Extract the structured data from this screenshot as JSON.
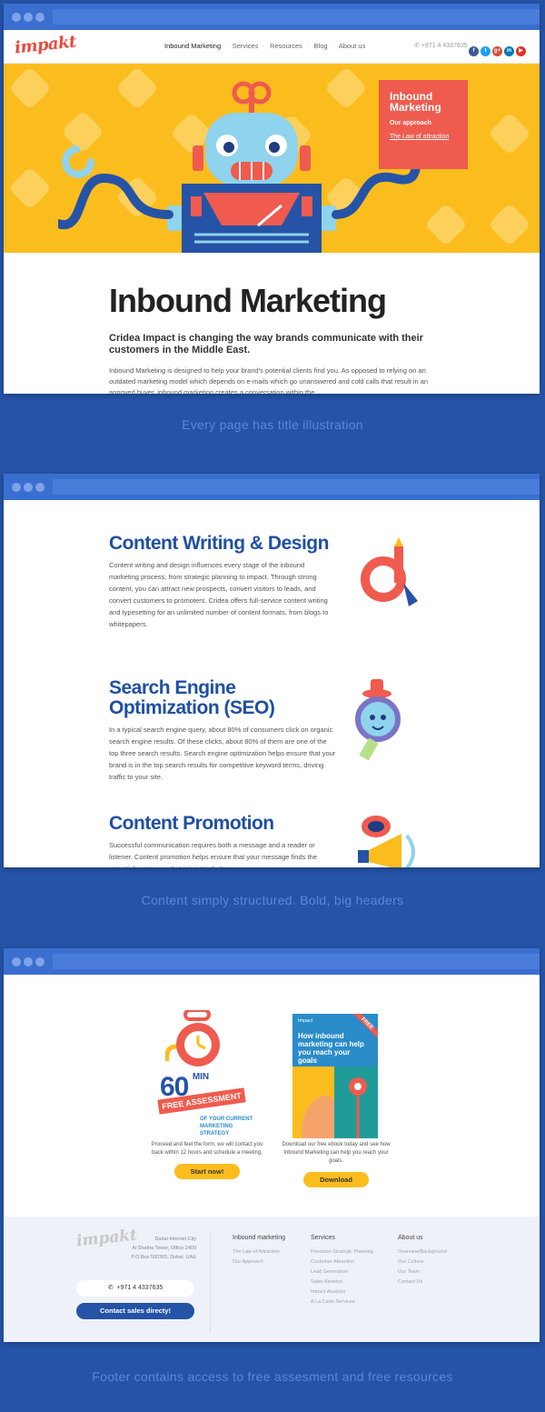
{
  "nav": {
    "logo": "impakt",
    "menu": [
      "Inbound Marketing",
      "Services",
      "Resources",
      "Blog",
      "About us"
    ],
    "phone": "+971 4 4337635",
    "social": [
      {
        "icon": "facebook-icon",
        "label": "f",
        "color": "#3b5998"
      },
      {
        "icon": "twitter-icon",
        "label": "t",
        "color": "#1da1f2"
      },
      {
        "icon": "google-plus-icon",
        "label": "g+",
        "color": "#dd4b39"
      },
      {
        "icon": "linkedin-icon",
        "label": "in",
        "color": "#0077b5"
      },
      {
        "icon": "youtube-icon",
        "label": "▶",
        "color": "#e52d27"
      }
    ]
  },
  "hero": {
    "box_title_1": "Inbound",
    "box_title_2": "Marketing",
    "box_link_1": "Our approach",
    "box_link_2": "The Law of attraction"
  },
  "article": {
    "title": "Inbound Marketing",
    "lead": "Cridea Impact is changing the way brands communicate with their customers in the Middle East.",
    "body": "Inbound Marketing is designed to help your brand's potential clients find you. As opposed to relying on an outdated marketing model which depends on e-mails which go unanswered and cold calls that result in an annoyed buyer, inbound marketing creates a conversation within the"
  },
  "captions": {
    "c1": "Every page has title illustration",
    "c2": "Content simply structured. Bold, big headers",
    "c3": "Footer contains access to free assesment and free resources"
  },
  "sections": [
    {
      "title": "Content Writing & Design",
      "text": "Content writing and design influences every stage of the inbound marketing process, from strategic planning to impact. Through strong content, you can attract new prospects, convert visitors to leads, and convert customers to promoters. Cridea offers full-service content writing and typesetting for an unlimited number of content formats, from blogs to whitepapers."
    },
    {
      "title": "Search Engine Optimization (SEO)",
      "text": "In a typical search engine query, about 80% of consumers click on organic search engine results. Of these clicks, about 80% of them are one of the top three search results. Search engine optimization helps ensure that your brand is in the top search results for competitive keyword terms, driving traffic to your site."
    },
    {
      "title": "Content Promotion",
      "text": "Successful communication requires both a message and a reader or listener. Content promotion helps ensure that your message finds the potential customers that it is intended to"
    }
  ],
  "assessment": {
    "num": "60",
    "min": "MIN",
    "ribbon": "FREE ASSESSMENT",
    "sub1": "OF YOUR CURRENT",
    "sub2": "MARKETING STRATEGY",
    "text": "Proceed and feel the form, we will contact you back within 12 hours and schedule a meeting.",
    "button": "Start now!"
  },
  "ebook": {
    "brand": "Impact",
    "title": "How inbound marketing can help you reach your goals",
    "badge": "FREE",
    "text": "Download our free ebook today and see how Inbound Marketing can help you reach your goals.",
    "button": "Download"
  },
  "footer": {
    "logo": "impakt",
    "addr1": "Dubai Internet City",
    "addr2": "Al Shatha Tower, Office 2409",
    "addr3": "P.O.Box 500365, Dubai, UAE",
    "phone": "+971 4 4337635",
    "sales": "Contact sales directy!",
    "cols": [
      {
        "heading": "Inbound marketing",
        "items": [
          "The Law of Attraction",
          "Our Approach"
        ]
      },
      {
        "heading": "Services",
        "items": [
          "Precision Strategic Planning",
          "Customer Attraction",
          "Lead Generation",
          "Sales Kinetics",
          "Impact Analysis",
          "A La Carte Services"
        ]
      },
      {
        "heading": "About us",
        "items": [
          "Overview/Background",
          "Our Culture",
          "Our Team",
          "Contact Us"
        ]
      }
    ]
  }
}
